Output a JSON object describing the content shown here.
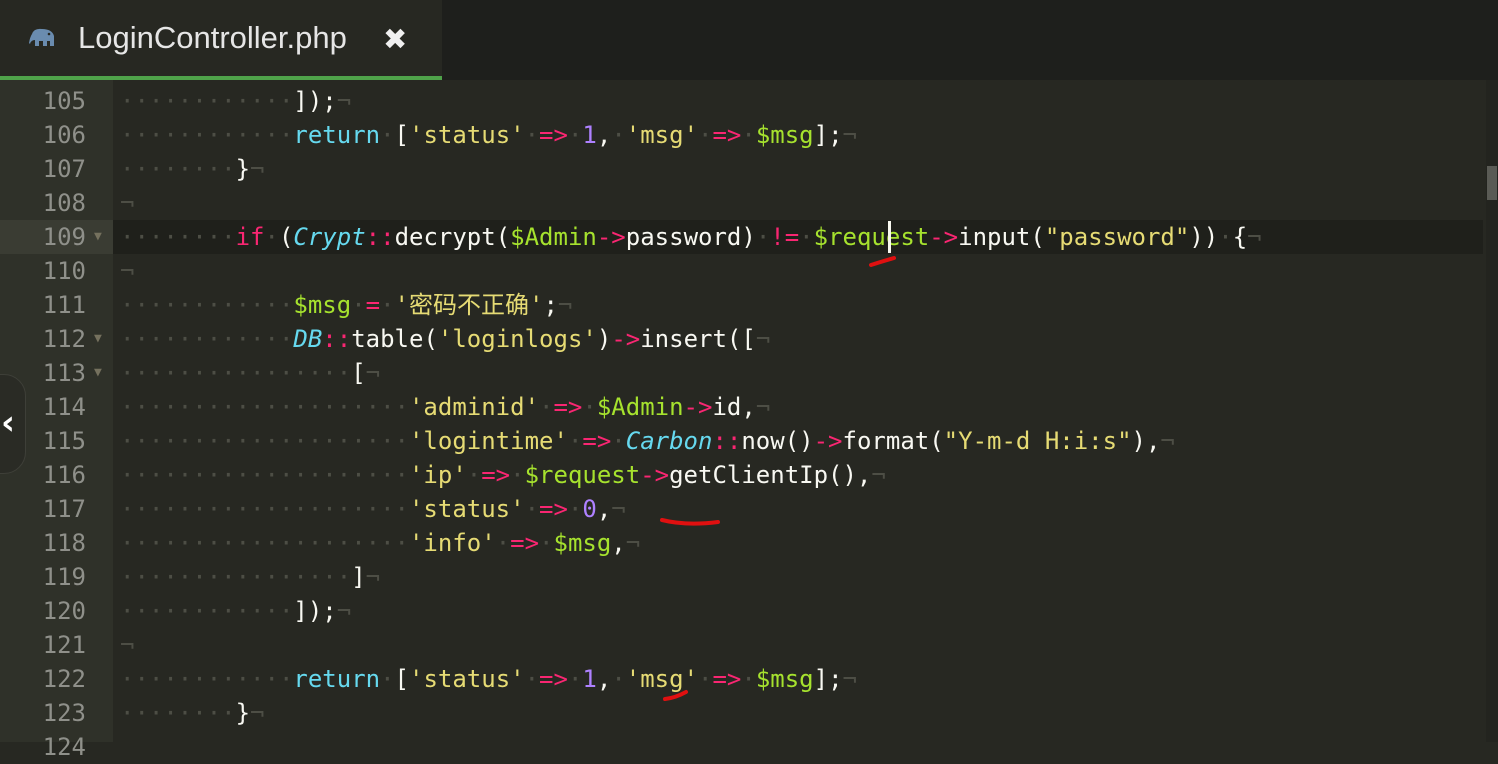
{
  "tab": {
    "title": "LoginController.php",
    "icon": "php-elephant-icon",
    "close_icon": "close-icon"
  },
  "colors": {
    "background": "#272822",
    "gutter": "#2f3129",
    "keyword": "#f92672",
    "string": "#e6db74",
    "number": "#ae81ff",
    "variable": "#a6e22e",
    "class": "#66d9ef",
    "annotation": "#e01010",
    "tab_accent": "#4fa34a"
  },
  "active_line": 109,
  "lines": [
    {
      "n": "105",
      "fold": false
    },
    {
      "n": "106",
      "fold": false
    },
    {
      "n": "107",
      "fold": false
    },
    {
      "n": "108",
      "fold": false
    },
    {
      "n": "109",
      "fold": true
    },
    {
      "n": "110",
      "fold": false
    },
    {
      "n": "111",
      "fold": false
    },
    {
      "n": "112",
      "fold": true
    },
    {
      "n": "113",
      "fold": true
    },
    {
      "n": "114",
      "fold": false
    },
    {
      "n": "115",
      "fold": false
    },
    {
      "n": "116",
      "fold": false
    },
    {
      "n": "117",
      "fold": false
    },
    {
      "n": "118",
      "fold": false
    },
    {
      "n": "119",
      "fold": false
    },
    {
      "n": "120",
      "fold": false
    },
    {
      "n": "121",
      "fold": false
    },
    {
      "n": "122",
      "fold": false
    },
    {
      "n": "123",
      "fold": false
    },
    {
      "n": "124",
      "fold": false
    }
  ],
  "tokens": {
    "t105": [
      [
        "ws",
        "········"
      ],
      [
        "ws",
        "····"
      ],
      [
        "pl",
        "]);"
      ],
      [
        "ws",
        "¬"
      ]
    ],
    "t106": [
      [
        "ws",
        "············"
      ],
      [
        "fn",
        "return"
      ],
      [
        "ws",
        "·"
      ],
      [
        "pl",
        "["
      ],
      [
        "str",
        "'status'"
      ],
      [
        "ws",
        "·"
      ],
      [
        "op",
        "=>"
      ],
      [
        "ws",
        "·"
      ],
      [
        "num",
        "1"
      ],
      [
        "pl",
        ","
      ],
      [
        "ws",
        "·"
      ],
      [
        "str",
        "'msg'"
      ],
      [
        "ws",
        "·"
      ],
      [
        "op",
        "=>"
      ],
      [
        "ws",
        "·"
      ],
      [
        "var",
        "$msg"
      ],
      [
        "pl",
        "];"
      ],
      [
        "ws",
        "¬"
      ]
    ],
    "t107": [
      [
        "ws",
        "········"
      ],
      [
        "pl",
        "}"
      ],
      [
        "ws",
        "¬"
      ]
    ],
    "t108": [
      [
        "ws",
        "¬"
      ]
    ],
    "t109": [
      [
        "ws",
        "········"
      ],
      [
        "kw",
        "if"
      ],
      [
        "ws",
        "·"
      ],
      [
        "pl",
        "("
      ],
      [
        "cls",
        "Crypt"
      ],
      [
        "op",
        "::"
      ],
      [
        "pl",
        "decrypt("
      ],
      [
        "var",
        "$Admin"
      ],
      [
        "op",
        "->"
      ],
      [
        "pl",
        "password)"
      ],
      [
        "ws",
        "·"
      ],
      [
        "op",
        "!="
      ],
      [
        "ws",
        "·"
      ],
      [
        "var",
        "$request"
      ],
      [
        "op",
        "->"
      ],
      [
        "pl",
        "input("
      ],
      [
        "str",
        "\"password\""
      ],
      [
        "pl",
        "))"
      ],
      [
        "ws",
        "·"
      ],
      [
        "pl",
        "{"
      ],
      [
        "ws",
        "¬"
      ]
    ],
    "t110": [
      [
        "ws",
        "¬"
      ]
    ],
    "t111": [
      [
        "ws",
        "············"
      ],
      [
        "var",
        "$msg"
      ],
      [
        "ws",
        "·"
      ],
      [
        "op",
        "="
      ],
      [
        "ws",
        "·"
      ],
      [
        "str",
        "'密码不正确'"
      ],
      [
        "pl",
        ";"
      ],
      [
        "ws",
        "¬"
      ]
    ],
    "t112": [
      [
        "ws",
        "············"
      ],
      [
        "cls",
        "DB"
      ],
      [
        "op",
        "::"
      ],
      [
        "pl",
        "table("
      ],
      [
        "str",
        "'loginlogs'"
      ],
      [
        "pl",
        ")"
      ],
      [
        "op",
        "->"
      ],
      [
        "pl",
        "insert(["
      ],
      [
        "ws",
        "¬"
      ]
    ],
    "t113": [
      [
        "ws",
        "················"
      ],
      [
        "pl",
        "["
      ],
      [
        "ws",
        "¬"
      ]
    ],
    "t114": [
      [
        "ws",
        "····················"
      ],
      [
        "str",
        "'adminid'"
      ],
      [
        "ws",
        "·"
      ],
      [
        "op",
        "=>"
      ],
      [
        "ws",
        "·"
      ],
      [
        "var",
        "$Admin"
      ],
      [
        "op",
        "->"
      ],
      [
        "pl",
        "id,"
      ],
      [
        "ws",
        "¬"
      ]
    ],
    "t115": [
      [
        "ws",
        "····················"
      ],
      [
        "str",
        "'logintime'"
      ],
      [
        "ws",
        "·"
      ],
      [
        "op",
        "=>"
      ],
      [
        "ws",
        "·"
      ],
      [
        "cls",
        "Carbon"
      ],
      [
        "op",
        "::"
      ],
      [
        "pl",
        "now()"
      ],
      [
        "op",
        "->"
      ],
      [
        "pl",
        "format("
      ],
      [
        "str",
        "\"Y-m-d H:i:s\""
      ],
      [
        "pl",
        "),"
      ],
      [
        "ws",
        "¬"
      ]
    ],
    "t116": [
      [
        "ws",
        "····················"
      ],
      [
        "str",
        "'ip'"
      ],
      [
        "ws",
        "·"
      ],
      [
        "op",
        "=>"
      ],
      [
        "ws",
        "·"
      ],
      [
        "var",
        "$request"
      ],
      [
        "op",
        "->"
      ],
      [
        "pl",
        "getClientIp(),"
      ],
      [
        "ws",
        "¬"
      ]
    ],
    "t117": [
      [
        "ws",
        "····················"
      ],
      [
        "str",
        "'status'"
      ],
      [
        "ws",
        "·"
      ],
      [
        "op",
        "=>"
      ],
      [
        "ws",
        "·"
      ],
      [
        "num",
        "0"
      ],
      [
        "pl",
        ","
      ],
      [
        "ws",
        "¬"
      ]
    ],
    "t118": [
      [
        "ws",
        "····················"
      ],
      [
        "str",
        "'info'"
      ],
      [
        "ws",
        "·"
      ],
      [
        "op",
        "=>"
      ],
      [
        "ws",
        "·"
      ],
      [
        "var",
        "$msg"
      ],
      [
        "pl",
        ","
      ],
      [
        "ws",
        "¬"
      ]
    ],
    "t119": [
      [
        "ws",
        "················"
      ],
      [
        "pl",
        "]"
      ],
      [
        "ws",
        "¬"
      ]
    ],
    "t120": [
      [
        "ws",
        "············"
      ],
      [
        "pl",
        "]);"
      ],
      [
        "ws",
        "¬"
      ]
    ],
    "t121": [
      [
        "ws",
        "¬"
      ]
    ],
    "t122": [
      [
        "ws",
        "············"
      ],
      [
        "fn",
        "return"
      ],
      [
        "ws",
        "·"
      ],
      [
        "pl",
        "["
      ],
      [
        "str",
        "'status'"
      ],
      [
        "ws",
        "·"
      ],
      [
        "op",
        "=>"
      ],
      [
        "ws",
        "·"
      ],
      [
        "num",
        "1"
      ],
      [
        "pl",
        ","
      ],
      [
        "ws",
        "·"
      ],
      [
        "str",
        "'msg'"
      ],
      [
        "ws",
        "·"
      ],
      [
        "op",
        "=>"
      ],
      [
        "ws",
        "·"
      ],
      [
        "var",
        "$msg"
      ],
      [
        "pl",
        "];"
      ],
      [
        "ws",
        "¬"
      ]
    ],
    "t123": [
      [
        "ws",
        "········"
      ],
      [
        "pl",
        "}"
      ],
      [
        "ws",
        "¬"
      ]
    ],
    "t124": []
  }
}
